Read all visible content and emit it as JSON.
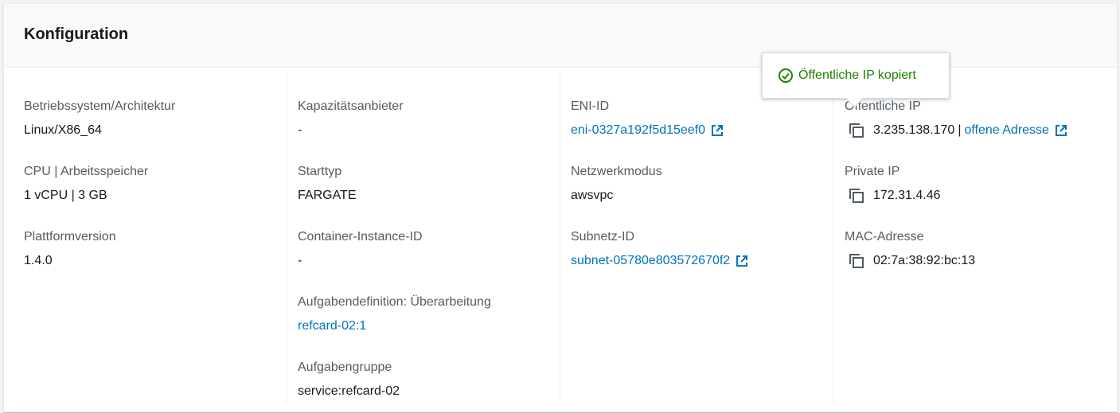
{
  "panel": {
    "title": "Konfiguration"
  },
  "columns": {
    "c1": [
      {
        "label": "Betriebssystem/Architektur",
        "value": "Linux/X86_64"
      },
      {
        "label": "CPU | Arbeitsspeicher",
        "value": "1 vCPU | 3 GB"
      },
      {
        "label": "Plattformversion",
        "value": "1.4.0"
      }
    ],
    "c2": [
      {
        "label": "Kapazitätsanbieter",
        "value": "-"
      },
      {
        "label": "Starttyp",
        "value": "FARGATE"
      },
      {
        "label": "Container-Instance-ID",
        "value": "-"
      },
      {
        "label": "Aufgabendefinition: Überarbeitung",
        "value": "refcard-02:1"
      },
      {
        "label": "Aufgabengruppe",
        "value": "service:refcard-02"
      }
    ],
    "c3": [
      {
        "label": "ENI-ID",
        "value": "eni-0327a192f5d15eef0"
      },
      {
        "label": "Netzwerkmodus",
        "value": "awsvpc"
      },
      {
        "label": "Subnetz-ID",
        "value": "subnet-05780e803572670f2"
      }
    ],
    "c4": [
      {
        "label": "Öffentliche IP",
        "value": "3.235.138.170",
        "separator": "|",
        "link": "offene Adresse"
      },
      {
        "label": "Private IP",
        "value": "172.31.4.46"
      },
      {
        "label": "MAC-Adresse",
        "value": "02:7a:38:92:bc:13"
      }
    ]
  },
  "tooltip": {
    "text": "Öffentliche IP kopiert",
    "icon": "check-circle-icon",
    "color": "#1d8102"
  },
  "colors": {
    "link": "#0073bb",
    "label": "#545b64",
    "text": "#16191f"
  }
}
